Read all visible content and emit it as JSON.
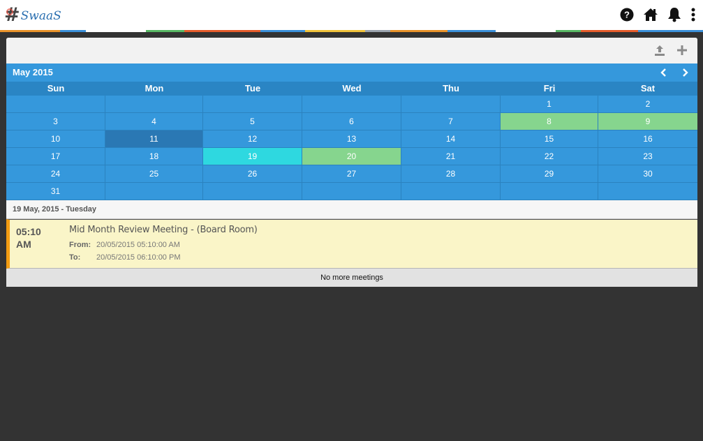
{
  "header": {
    "logo_text": "SwaaS",
    "icons": [
      "help-icon",
      "home-icon",
      "bell-icon",
      "more-vertical-icon"
    ]
  },
  "stripe_colors": [
    "#e8922a",
    "#3a8fd8",
    "#ffffff",
    "#58b864",
    "#e55c2b",
    "#3a8fd8",
    "#f0c23a",
    "#9aa3ad"
  ],
  "toolbar": {
    "icons": [
      "upload-icon",
      "plus-icon"
    ]
  },
  "calendar": {
    "month_label": "May 2015",
    "weekdays": [
      "Sun",
      "Mon",
      "Tue",
      "Wed",
      "Thu",
      "Fri",
      "Sat"
    ],
    "weeks": [
      [
        "",
        "",
        "",
        "",
        "",
        "1",
        "2"
      ],
      [
        "3",
        "4",
        "5",
        "6",
        "7",
        "8",
        "9"
      ],
      [
        "10",
        "11",
        "12",
        "13",
        "14",
        "15",
        "16"
      ],
      [
        "17",
        "18",
        "19",
        "20",
        "21",
        "22",
        "23"
      ],
      [
        "24",
        "25",
        "26",
        "27",
        "28",
        "29",
        "30"
      ],
      [
        "31",
        "",
        "",
        "",
        "",
        "",
        ""
      ]
    ],
    "highlights": {
      "8": "green",
      "9": "green",
      "11": "dark",
      "19": "cyan",
      "20": "green"
    },
    "colors": {
      "cell": "#3598dc",
      "green": "#86d58e",
      "cyan": "#2ed8e0",
      "today": "#2a78b4"
    }
  },
  "selected_date": "19 May, 2015 - Tuesday",
  "meeting": {
    "time": "05:10",
    "ampm": "AM",
    "title": "Mid Month Review Meeting - (Board Room)",
    "from_label": "From:",
    "from_value": "20/05/2015 05:10:00 AM",
    "to_label": "To:",
    "to_value": "20/05/2015 06:10:00 PM",
    "accent": "#f39c12"
  },
  "footer_note": "No more meetings"
}
